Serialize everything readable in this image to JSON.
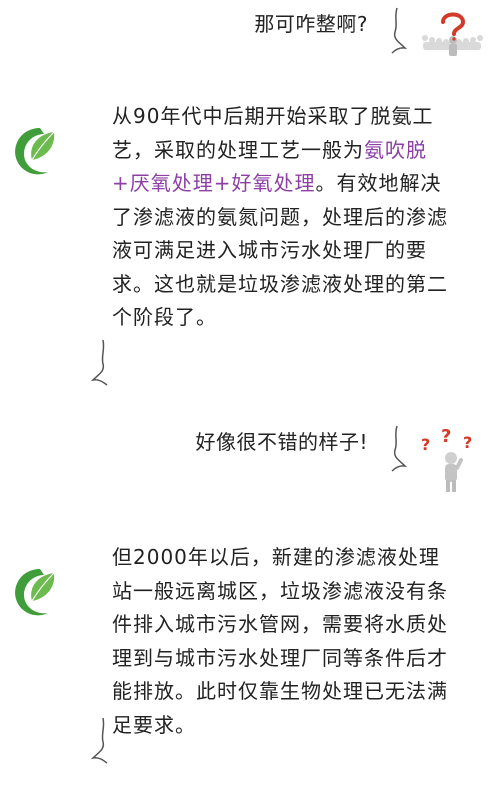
{
  "dialog": {
    "q1": "那可咋整啊?",
    "a1_pre": "从90年代中后期开始采取了脱氨工艺，采取的处理工艺一般为",
    "a1_highlight": "氨吹脱+厌氧处理+好氧处理",
    "a1_post": "。有效地解决了渗滤液的氨氮问题，处理后的渗滤液可满足进入城市污水处理厂的要求。这也就是垃圾渗滤液处理的第二个阶段了。",
    "q2": "好像很不错的样子!",
    "a2": "但2000年以后，新建的渗滤液处理站一般远离城区，垃圾渗滤液没有条件排入城市污水管网，需要将水质处理到与城市污水处理厂同等条件后才能排放。此时仅靠生物处理已无法满足要求。"
  },
  "colors": {
    "highlight": "#8d3fa5",
    "logo_green": "#3f9e3a",
    "question_mark_red": "#d23a2a"
  },
  "icons": [
    "brand-leaf-logo",
    "crowd-question-icon",
    "thinking-person-icon"
  ]
}
